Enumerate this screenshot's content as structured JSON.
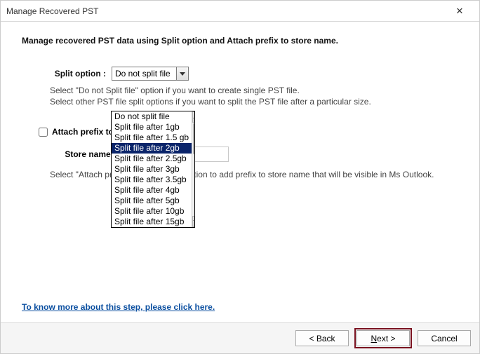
{
  "window": {
    "title": "Manage Recovered PST",
    "close": "✕"
  },
  "heading": "Manage recovered PST data using Split option and Attach prefix to store name.",
  "split": {
    "label": "Split option :",
    "selected": "Do not split file",
    "hint_line1": "Select \"Do not Split file\" option if you want to create single PST file.",
    "hint_line2": "Select other PST file split options if you want to split the PST file after a particular size.",
    "options": [
      "Do not split file",
      "Split file after 1gb",
      "Split file after 1.5 gb",
      "Split file after 2gb",
      "Split file after 2.5gb",
      "Split file after 3gb",
      "Split file after 3.5gb",
      "Split file after 4gb",
      "Split file after 5gb",
      "Split file after 10gb",
      "Split file after 15gb"
    ],
    "highlighted_index": 3
  },
  "prefix": {
    "checkbox_label": "Attach prefix to store name",
    "store_label": "Store name :",
    "store_value": "",
    "hint": "Select \"Attach prefix to store name\" option to add prefix to store name that will be visible in Ms Outlook."
  },
  "help_link": "To know more about this step, please click here.",
  "footer": {
    "back": "< Back",
    "next": "Next >",
    "cancel": "Cancel"
  }
}
